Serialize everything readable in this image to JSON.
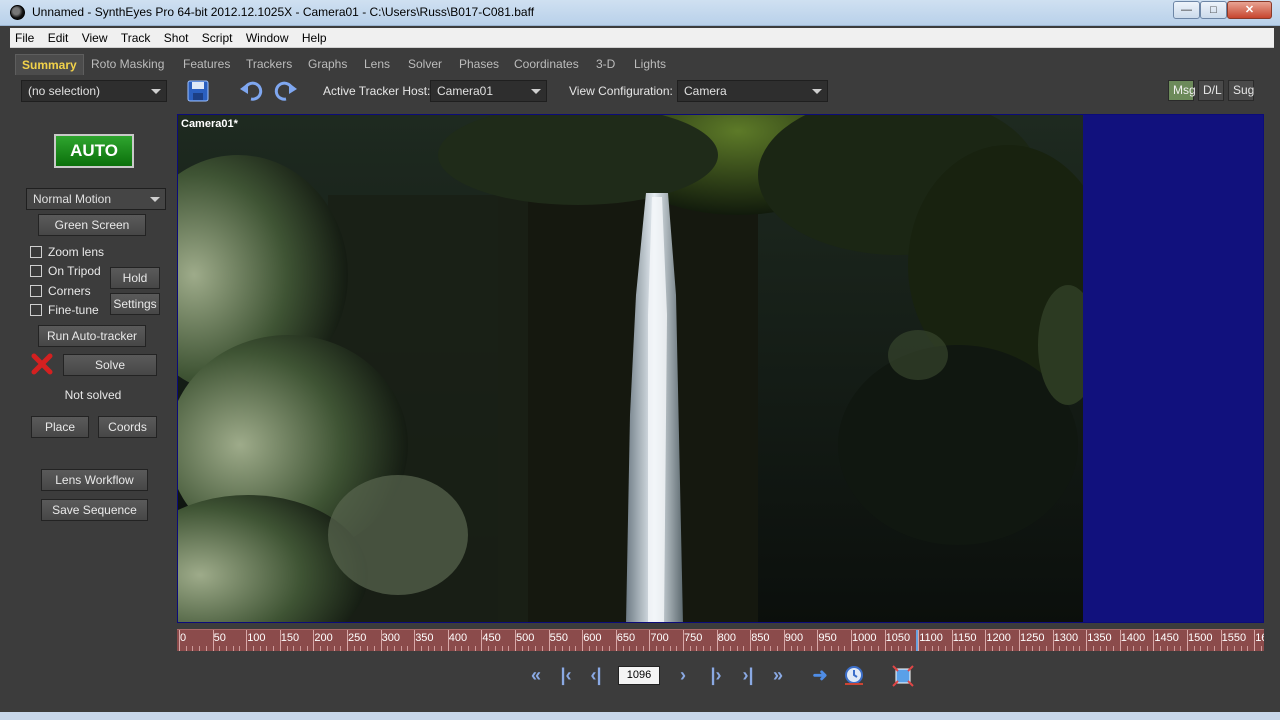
{
  "window": {
    "title": "Unnamed - SynthEyes Pro 64-bit 2012.12.1025X - Camera01 - C:\\Users\\Russ\\B017-C081.baff",
    "min_icon": "minimize-icon",
    "max_icon": "maximize-icon",
    "close_icon": "close-icon"
  },
  "menu": [
    "File",
    "Edit",
    "View",
    "Track",
    "Shot",
    "Script",
    "Window",
    "Help"
  ],
  "tabs": [
    "Summary",
    "Roto Masking",
    "Features",
    "Trackers",
    "Graphs",
    "Lens",
    "Solver",
    "Phases",
    "Coordinates",
    "3-D",
    "Lights"
  ],
  "active_tab": "Summary",
  "toolbar": {
    "selection": "(no selection)",
    "active_tracker_host_label": "Active Tracker Host:",
    "active_tracker_host": "Camera01",
    "view_configuration_label": "View Configuration:",
    "view_configuration": "Camera",
    "msg": "Msg",
    "dl": "D/L",
    "sug": "Sug"
  },
  "left_panel": {
    "auto": "AUTO",
    "motion": "Normal Motion",
    "green_screen": "Green Screen",
    "zoom_lens": "Zoom lens",
    "on_tripod": "On Tripod",
    "corners": "Corners",
    "fine_tune": "Fine-tune",
    "hold": "Hold",
    "settings": "Settings",
    "run_auto_tracker": "Run Auto-tracker",
    "solve": "Solve",
    "status": "Not solved",
    "place": "Place",
    "coords": "Coords",
    "lens_workflow": "Lens Workflow",
    "save_sequence": "Save Sequence"
  },
  "viewport": {
    "label": "Camera01*"
  },
  "timeline": {
    "ticks": [
      "0",
      "50",
      "100",
      "150",
      "200",
      "250",
      "300",
      "350",
      "400",
      "450",
      "500",
      "550",
      "600",
      "650",
      "700",
      "750",
      "800",
      "850",
      "900",
      "950",
      "1000",
      "1050",
      "1100",
      "1150",
      "1200",
      "1250",
      "1300",
      "1350",
      "1400",
      "1450",
      "1500",
      "1550",
      "16"
    ],
    "current_frame": 1096
  },
  "transport": {
    "frame": "1096"
  },
  "colors": {
    "auto_green": "#1c8c1c",
    "timeline_red": "#8b4b4b",
    "viewport_blue": "#11117d",
    "active_tab_yellow": "#f2d24a"
  }
}
